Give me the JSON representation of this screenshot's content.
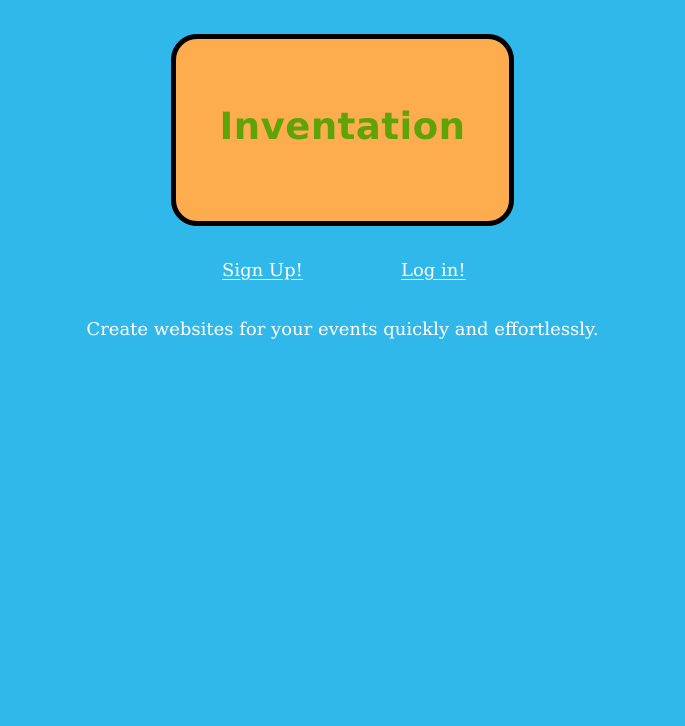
{
  "logo": {
    "text": "Inventation",
    "box_color": "#fdad4e",
    "text_color": "#5fa20a",
    "border_color": "#000000"
  },
  "nav": {
    "signup_label": "Sign Up!",
    "login_label": "Log in!"
  },
  "tagline": "Create websites for your events quickly and effortlessly.",
  "colors": {
    "background": "#31b8eb",
    "link": "#ffffff"
  }
}
